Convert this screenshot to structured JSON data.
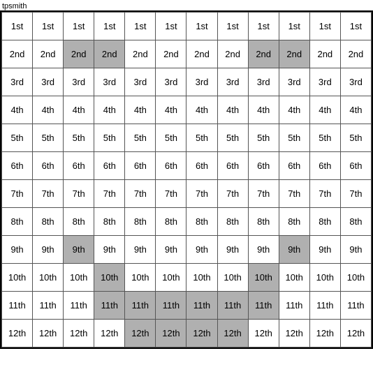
{
  "title": "tpsmith",
  "rows": [
    {
      "label": "1st",
      "cells": [
        {
          "text": "1st",
          "highlight": false
        },
        {
          "text": "1st",
          "highlight": false
        },
        {
          "text": "1st",
          "highlight": false
        },
        {
          "text": "1st",
          "highlight": false
        },
        {
          "text": "1st",
          "highlight": false
        },
        {
          "text": "1st",
          "highlight": false
        },
        {
          "text": "1st",
          "highlight": false
        },
        {
          "text": "1st",
          "highlight": false
        },
        {
          "text": "1st",
          "highlight": false
        },
        {
          "text": "1st",
          "highlight": false
        },
        {
          "text": "1st",
          "highlight": false
        },
        {
          "text": "1st",
          "highlight": false
        }
      ]
    },
    {
      "label": "2nd",
      "cells": [
        {
          "text": "2nd",
          "highlight": false
        },
        {
          "text": "2nd",
          "highlight": false
        },
        {
          "text": "2nd",
          "highlight": true
        },
        {
          "text": "2nd",
          "highlight": true
        },
        {
          "text": "2nd",
          "highlight": false
        },
        {
          "text": "2nd",
          "highlight": false
        },
        {
          "text": "2nd",
          "highlight": false
        },
        {
          "text": "2nd",
          "highlight": false
        },
        {
          "text": "2nd",
          "highlight": true
        },
        {
          "text": "2nd",
          "highlight": true
        },
        {
          "text": "2nd",
          "highlight": false
        },
        {
          "text": "2nd",
          "highlight": false
        }
      ]
    },
    {
      "label": "3rd",
      "cells": [
        {
          "text": "3rd",
          "highlight": false
        },
        {
          "text": "3rd",
          "highlight": false
        },
        {
          "text": "3rd",
          "highlight": false
        },
        {
          "text": "3rd",
          "highlight": false
        },
        {
          "text": "3rd",
          "highlight": false
        },
        {
          "text": "3rd",
          "highlight": false
        },
        {
          "text": "3rd",
          "highlight": false
        },
        {
          "text": "3rd",
          "highlight": false
        },
        {
          "text": "3rd",
          "highlight": false
        },
        {
          "text": "3rd",
          "highlight": false
        },
        {
          "text": "3rd",
          "highlight": false
        },
        {
          "text": "3rd",
          "highlight": false
        }
      ]
    },
    {
      "label": "4th",
      "cells": [
        {
          "text": "4th",
          "highlight": false
        },
        {
          "text": "4th",
          "highlight": false
        },
        {
          "text": "4th",
          "highlight": false
        },
        {
          "text": "4th",
          "highlight": false
        },
        {
          "text": "4th",
          "highlight": false
        },
        {
          "text": "4th",
          "highlight": false
        },
        {
          "text": "4th",
          "highlight": false
        },
        {
          "text": "4th",
          "highlight": false
        },
        {
          "text": "4th",
          "highlight": false
        },
        {
          "text": "4th",
          "highlight": false
        },
        {
          "text": "4th",
          "highlight": false
        },
        {
          "text": "4th",
          "highlight": false
        }
      ]
    },
    {
      "label": "5th",
      "cells": [
        {
          "text": "5th",
          "highlight": false
        },
        {
          "text": "5th",
          "highlight": false
        },
        {
          "text": "5th",
          "highlight": false
        },
        {
          "text": "5th",
          "highlight": false
        },
        {
          "text": "5th",
          "highlight": false
        },
        {
          "text": "5th",
          "highlight": false
        },
        {
          "text": "5th",
          "highlight": false
        },
        {
          "text": "5th",
          "highlight": false
        },
        {
          "text": "5th",
          "highlight": false
        },
        {
          "text": "5th",
          "highlight": false
        },
        {
          "text": "5th",
          "highlight": false
        },
        {
          "text": "5th",
          "highlight": false
        }
      ]
    },
    {
      "label": "6th",
      "cells": [
        {
          "text": "6th",
          "highlight": false
        },
        {
          "text": "6th",
          "highlight": false
        },
        {
          "text": "6th",
          "highlight": false
        },
        {
          "text": "6th",
          "highlight": false
        },
        {
          "text": "6th",
          "highlight": false
        },
        {
          "text": "6th",
          "highlight": false
        },
        {
          "text": "6th",
          "highlight": false
        },
        {
          "text": "6th",
          "highlight": false
        },
        {
          "text": "6th",
          "highlight": false
        },
        {
          "text": "6th",
          "highlight": false
        },
        {
          "text": "6th",
          "highlight": false
        },
        {
          "text": "6th",
          "highlight": false
        }
      ]
    },
    {
      "label": "7th",
      "cells": [
        {
          "text": "7th",
          "highlight": false
        },
        {
          "text": "7th",
          "highlight": false
        },
        {
          "text": "7th",
          "highlight": false
        },
        {
          "text": "7th",
          "highlight": false
        },
        {
          "text": "7th",
          "highlight": false
        },
        {
          "text": "7th",
          "highlight": false
        },
        {
          "text": "7th",
          "highlight": false
        },
        {
          "text": "7th",
          "highlight": false
        },
        {
          "text": "7th",
          "highlight": false
        },
        {
          "text": "7th",
          "highlight": false
        },
        {
          "text": "7th",
          "highlight": false
        },
        {
          "text": "7th",
          "highlight": false
        }
      ]
    },
    {
      "label": "8th",
      "cells": [
        {
          "text": "8th",
          "highlight": false
        },
        {
          "text": "8th",
          "highlight": false
        },
        {
          "text": "8th",
          "highlight": false
        },
        {
          "text": "8th",
          "highlight": false
        },
        {
          "text": "8th",
          "highlight": false
        },
        {
          "text": "8th",
          "highlight": false
        },
        {
          "text": "8th",
          "highlight": false
        },
        {
          "text": "8th",
          "highlight": false
        },
        {
          "text": "8th",
          "highlight": false
        },
        {
          "text": "8th",
          "highlight": false
        },
        {
          "text": "8th",
          "highlight": false
        },
        {
          "text": "8th",
          "highlight": false
        }
      ]
    },
    {
      "label": "9th",
      "cells": [
        {
          "text": "9th",
          "highlight": false
        },
        {
          "text": "9th",
          "highlight": false
        },
        {
          "text": "9th",
          "highlight": true
        },
        {
          "text": "9th",
          "highlight": false
        },
        {
          "text": "9th",
          "highlight": false
        },
        {
          "text": "9th",
          "highlight": false
        },
        {
          "text": "9th",
          "highlight": false
        },
        {
          "text": "9th",
          "highlight": false
        },
        {
          "text": "9th",
          "highlight": false
        },
        {
          "text": "9th",
          "highlight": true
        },
        {
          "text": "9th",
          "highlight": false
        },
        {
          "text": "9th",
          "highlight": false
        }
      ]
    },
    {
      "label": "10th",
      "cells": [
        {
          "text": "10th",
          "highlight": false
        },
        {
          "text": "10th",
          "highlight": false
        },
        {
          "text": "10th",
          "highlight": false
        },
        {
          "text": "10th",
          "highlight": true
        },
        {
          "text": "10th",
          "highlight": false
        },
        {
          "text": "10th",
          "highlight": false
        },
        {
          "text": "10th",
          "highlight": false
        },
        {
          "text": "10th",
          "highlight": false
        },
        {
          "text": "10th",
          "highlight": true
        },
        {
          "text": "10th",
          "highlight": false
        },
        {
          "text": "10th",
          "highlight": false
        },
        {
          "text": "10th",
          "highlight": false
        }
      ]
    },
    {
      "label": "11th",
      "cells": [
        {
          "text": "11th",
          "highlight": false
        },
        {
          "text": "11th",
          "highlight": false
        },
        {
          "text": "11th",
          "highlight": false
        },
        {
          "text": "11th",
          "highlight": true
        },
        {
          "text": "11th",
          "highlight": true
        },
        {
          "text": "11th",
          "highlight": true
        },
        {
          "text": "11th",
          "highlight": true
        },
        {
          "text": "11th",
          "highlight": true
        },
        {
          "text": "11th",
          "highlight": true
        },
        {
          "text": "11th",
          "highlight": false
        },
        {
          "text": "11th",
          "highlight": false
        },
        {
          "text": "11th",
          "highlight": false
        }
      ]
    },
    {
      "label": "12th",
      "cells": [
        {
          "text": "12th",
          "highlight": false
        },
        {
          "text": "12th",
          "highlight": false
        },
        {
          "text": "12th",
          "highlight": false
        },
        {
          "text": "12th",
          "highlight": false
        },
        {
          "text": "12th",
          "highlight": true
        },
        {
          "text": "12th",
          "highlight": true
        },
        {
          "text": "12th",
          "highlight": true
        },
        {
          "text": "12th",
          "highlight": true
        },
        {
          "text": "12th",
          "highlight": false
        },
        {
          "text": "12th",
          "highlight": false
        },
        {
          "text": "12th",
          "highlight": false
        },
        {
          "text": "12th",
          "highlight": false
        }
      ]
    }
  ]
}
